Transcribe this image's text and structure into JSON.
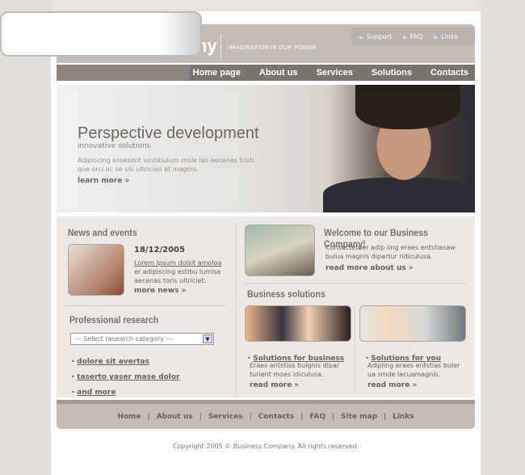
{
  "header": {
    "logo_tail": "ny",
    "slogan": "IMAGINATION IS OUR POWER",
    "top_links": [
      "Support",
      "FAQ",
      "Links"
    ]
  },
  "nav": [
    "Home page",
    "About us",
    "Services",
    "Solutions",
    "Contacts"
  ],
  "hero": {
    "title": "Perspective development",
    "subtitle": "innovative solutions",
    "desc": "Adipiscing eraesent vestibulum mole las aecenas tristi que orci ac se uis ultricieo et magnis.",
    "more": "learn more »"
  },
  "news": {
    "title": "News and events",
    "date": "18/12/2005",
    "link": "Lorem ipsum dolsit amoloa",
    "text": "er adipiscing estibu lumlsa aecenas toris ultriciet.",
    "more": "more news »"
  },
  "research": {
    "title": "Professional research",
    "select": "--- Select research category ---",
    "links": [
      "dolore sit avertas",
      "taserto yaser mase dolor",
      "and more"
    ]
  },
  "welcome": {
    "title": "Welcome to our Business Company!",
    "text": "Consectetuer adip iing eraes entstiasaw bulua magnis dipartur ridiculusa.",
    "more": "read more about us »"
  },
  "solutions": {
    "title": "Business solutions",
    "items": [
      {
        "title": "Solutions for business",
        "text": "Eraes entstias bulgnis dipar turient moes idiculusa.",
        "more": "read more »"
      },
      {
        "title": "Solutions for you",
        "text": "Adipiing eraes entstias buler ua smde lacuamagnis.",
        "more": "read more »"
      }
    ]
  },
  "footer": {
    "links": [
      "Home",
      "About us",
      "Services",
      "Contacts",
      "FAQ",
      "Site map",
      "Links"
    ],
    "copyright": "Copyright 2005 © Business Company. All rights reserved."
  }
}
